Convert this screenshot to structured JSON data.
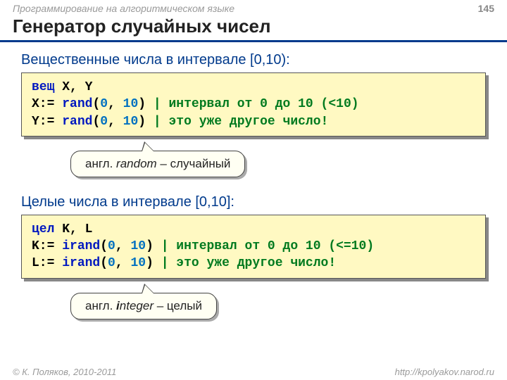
{
  "header": {
    "course": "Программирование на алгоритмическом языке",
    "page": "145"
  },
  "title": "Генератор случайных чисел",
  "section1": {
    "heading": "Вещественные числа в интервале [0,10):",
    "code": {
      "decl_kw": "вещ",
      "decl_vars": " X, Y",
      "l2a": "X:= ",
      "l2fn": "rand",
      "l2p": "(",
      "l2n0": "0",
      "l2c": ", ",
      "l2n1": "10",
      "l2q": ")",
      "l2cm": " | интервал от 0 до 10 (<10)",
      "l3a": "Y:= ",
      "l3fn": "rand",
      "l3p": "(",
      "l3n0": "0",
      "l3c": ", ",
      "l3n1": "10",
      "l3q": ")",
      "l3cm": " | это уже другое число!"
    },
    "callout_pre": "англ. ",
    "callout_it": "random",
    "callout_post": " – случайный"
  },
  "section2": {
    "heading": "Целые числа в интервале [0,10]:",
    "code": {
      "decl_kw": "цел",
      "decl_vars": " K, L",
      "l2a": "K:= ",
      "l2fn": "irand",
      "l2p": "(",
      "l2n0": "0",
      "l2c": ", ",
      "l2n1": "10",
      "l2q": ")",
      "l2cm": " | интервал от 0 до 10 (<=10)",
      "l3a": "L:= ",
      "l3fn": "irand",
      "l3p": "(",
      "l3n0": "0",
      "l3c": ", ",
      "l3n1": "10",
      "l3q": ")",
      "l3cm": " | это уже другое число!"
    },
    "callout_pre": "англ. ",
    "callout_bold": "i",
    "callout_it": "nteger",
    "callout_post": " – целый"
  },
  "footer": {
    "copyright": "© К. Поляков, 2010-2011",
    "url": "http://kpolyakov.narod.ru"
  }
}
